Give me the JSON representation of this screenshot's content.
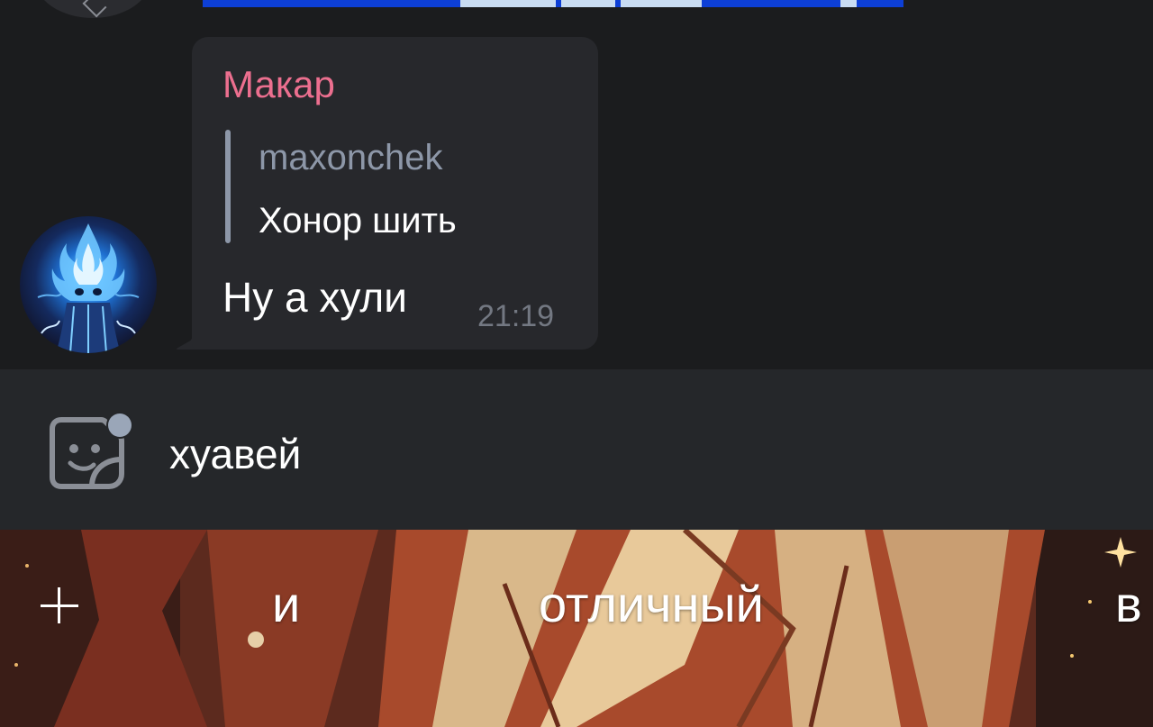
{
  "message": {
    "sender": "Макар",
    "reply": {
      "author": "maxonchek",
      "text": "Хонор шить"
    },
    "text": "Ну а хули",
    "time": "21:19"
  },
  "composer": {
    "value": "хуавей",
    "sticker_icon": "sticker-icon"
  },
  "keyboard": {
    "suggestions": [
      "и",
      "отличный",
      "в"
    ]
  },
  "colors": {
    "sender": "#ec6f8f",
    "reply_accent": "#8d97a8",
    "bubble": "#27282c",
    "chat_bg": "#1b1c1e",
    "composer_bg": "#25272a"
  }
}
